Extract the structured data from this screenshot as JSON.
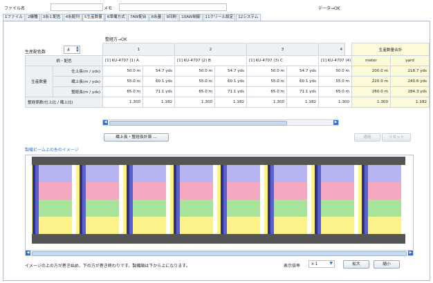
{
  "header": {
    "file_label": "ファイル名",
    "memo_label": "メモ",
    "status": "データ→OK"
  },
  "tabs": [
    "1ファイル",
    "2機種",
    "3糸と配色",
    "4糸配列",
    "5生産数量",
    "6準備方式",
    "7AW配台",
    "8糸量",
    "9印刷",
    "10AW制御",
    "11クリール設定",
    "12システム"
  ],
  "active_tab": 4,
  "warp_status": "整経方→OK",
  "color_count": {
    "label": "生産配色数",
    "value": "4"
  },
  "table": {
    "col_numbers": [
      "1",
      "2",
      "3",
      "4"
    ],
    "sum_header": "生産数量合計",
    "row_header": "柄・配色",
    "products": [
      "[1] KU-4707 (1) A",
      "[1] KU-4707 (2) B",
      "[1] KU-4707 (3) C",
      "[1] KU-4707 (4)"
    ],
    "unit_headers": [
      "meter",
      "yard"
    ],
    "group_label": "生産数量",
    "rows": [
      {
        "label": "仕上長(m / yds)",
        "cells": [
          "50.0 m",
          "54.7 yds",
          "50.0 m",
          "54.7 yds",
          "50.0 m",
          "54.7 yds",
          "50.0 m"
        ],
        "sum": [
          "200.0 m",
          "218.7 yds"
        ]
      },
      {
        "label": "織上長(m / yds)",
        "cells": [
          "55.0 m",
          "60.1 yds",
          "55.0 m",
          "60.1 yds",
          "55.0 m",
          "60.1 yds",
          "55.0 m"
        ],
        "sum": [
          "220.0 m",
          "240.6 yds"
        ]
      },
      {
        "label": "整経長(m / yds)",
        "cells": [
          "65.0 m",
          "71.1 yds",
          "65.0 m",
          "71.1 yds",
          "65.0 m",
          "71.1 yds",
          "65.0 m"
        ],
        "sum": [
          "260.0 m",
          "284.3 yds"
        ]
      }
    ],
    "coef": {
      "label": "整経係数(仕上比 / 織上比)",
      "cells": [
        "1.300",
        "1.182",
        "1.300",
        "1.182",
        "1.300",
        "1.182",
        "1.300"
      ],
      "sum": [
        "1.300",
        "1.182"
      ]
    }
  },
  "calc_button": "織上長・整経長計算 ...",
  "apply_button": "適用",
  "reset_button": "リセット",
  "beam_title": "製織ビーム上の糸のイメージ",
  "footer_note": "イメージの上の方が巻き始め、下の方が巻き終わりです。製織順は下から上になります。",
  "zoom": {
    "label": "表示倍率",
    "value": "x 1",
    "zoom_in": "拡大",
    "zoom_out": "縮小"
  },
  "colors": {
    "purple": "#b5b3f0",
    "pink": "#f4a7bf",
    "green": "#a7e39a",
    "yellow": "#fbf28c",
    "navy": "#2c2f8f",
    "blue": "#5b61c8",
    "white": "#ffffff",
    "gray": "#6b6b6b"
  }
}
